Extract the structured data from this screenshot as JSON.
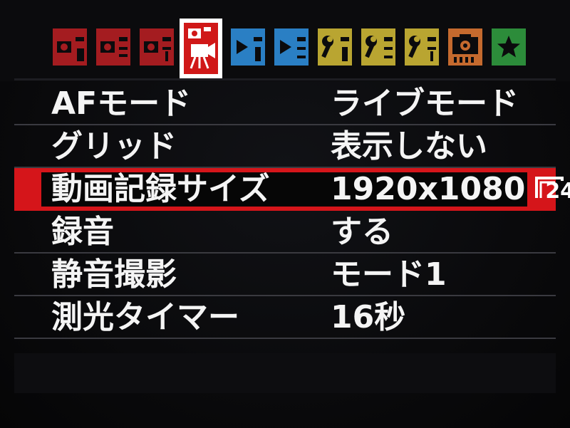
{
  "tabs": [
    {
      "icon": "camera-shooting-icon",
      "color": "#b01f22"
    },
    {
      "icon": "camera-shooting-icon",
      "color": "#b01f22"
    },
    {
      "icon": "camera-shooting-icon",
      "color": "#b01f22"
    },
    {
      "icon": "live-view-movie-icon",
      "color": "#d01818"
    },
    {
      "icon": "playback-icon",
      "color": "#2a7fc4"
    },
    {
      "icon": "playback-icon",
      "color": "#2a7fc4"
    },
    {
      "icon": "setup-wrench-icon",
      "color": "#b9a531"
    },
    {
      "icon": "setup-wrench-icon",
      "color": "#b9a531"
    },
    {
      "icon": "setup-wrench-icon",
      "color": "#b9a531"
    },
    {
      "icon": "custom-function-icon",
      "color": "#c56a2e"
    },
    {
      "icon": "my-menu-star-icon",
      "color": "#2c8c3a"
    }
  ],
  "menu": {
    "items": [
      {
        "label": "AFモード",
        "value": "ライブモード"
      },
      {
        "label": "グリッド",
        "value": "表示しない"
      },
      {
        "label": "動画記録サイズ",
        "value": "1920x1080",
        "badge": "24"
      },
      {
        "label": "録音",
        "value": "する"
      },
      {
        "label": "静音撮影",
        "value": "モード1"
      },
      {
        "label": "測光タイマー",
        "value": "16秒"
      }
    ]
  },
  "colors": {
    "selection": "#d5151a",
    "text": "#f4f4f4",
    "background": "#0a0a0c"
  }
}
